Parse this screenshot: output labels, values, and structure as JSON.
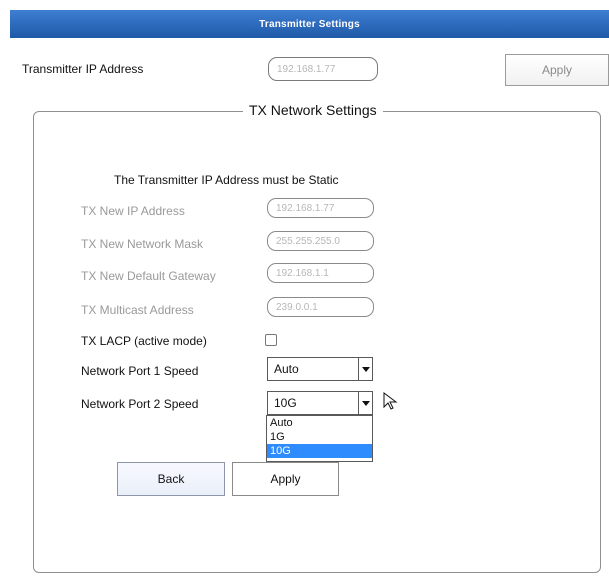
{
  "window": {
    "title": "Transmitter Settings"
  },
  "top": {
    "ip_label": "Transmitter IP Address",
    "ip_value": "192.168.1.77",
    "apply_label": "Apply"
  },
  "group": {
    "title": "TX Network Settings",
    "note": "The Transmitter IP Address must be Static",
    "fields": {
      "new_ip": {
        "label": "TX New IP Address",
        "value": "192.168.1.77"
      },
      "mask": {
        "label": "TX New Network Mask",
        "value": "255.255.255.0"
      },
      "gateway": {
        "label": "TX New Default Gateway",
        "value": "192.168.1.1"
      },
      "multicast": {
        "label": "TX Multicast Address",
        "value": "239.0.0.1"
      },
      "lacp": {
        "label": "TX LACP (active mode)",
        "checked": false
      },
      "port1": {
        "label": "Network Port 1 Speed",
        "value": "Auto"
      },
      "port2": {
        "label": "Network Port 2 Speed",
        "value": "10G",
        "options": [
          "Auto",
          "1G",
          "10G"
        ],
        "selected_index": 2
      }
    },
    "buttons": {
      "back": "Back",
      "apply": "Apply"
    }
  },
  "colors": {
    "titlebar": "#2f6dbf",
    "selected_option": "#2f8cff",
    "muted_text": "#9a9a9a"
  },
  "icons": {
    "cursor": "arrow-cursor-icon"
  }
}
